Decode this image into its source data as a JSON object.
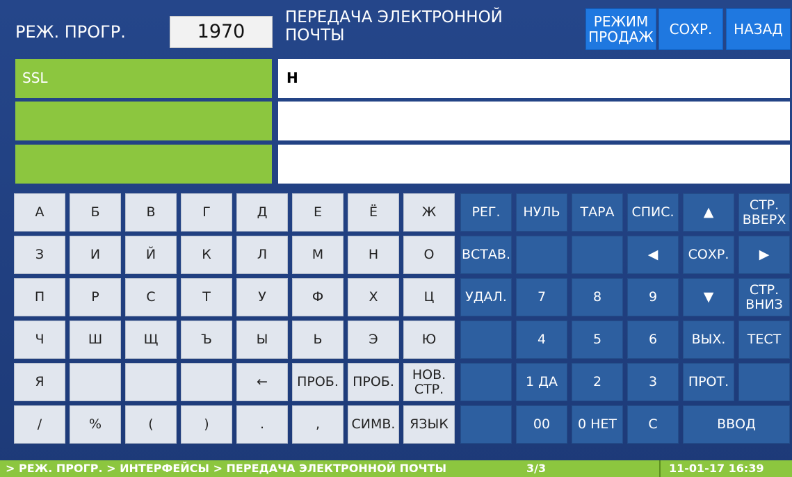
{
  "header": {
    "mode_label": "РЕЖ. ПРОГР.",
    "program_code": "1970",
    "title": "ПЕРЕДАЧА ЭЛЕКТРОННОЙ ПОЧТЫ",
    "buttons": {
      "sales_mode": "РЕЖИМ ПРОДАЖ",
      "save": "СОХР.",
      "back": "НАЗАД"
    },
    "accent_color": "#1f78e0"
  },
  "fields": [
    {
      "label": "SSL",
      "value": "Н"
    },
    {
      "label": "",
      "value": ""
    },
    {
      "label": "",
      "value": ""
    }
  ],
  "keyboard": {
    "letters": {
      "r1": [
        "А",
        "Б",
        "В",
        "Г",
        "Д",
        "Е",
        "Ё",
        "Ж"
      ],
      "r2": [
        "З",
        "И",
        "Й",
        "К",
        "Л",
        "М",
        "Н",
        "О"
      ],
      "r3": [
        "П",
        "Р",
        "С",
        "Т",
        "У",
        "Ф",
        "Х",
        "Ц"
      ],
      "r4": [
        "Ч",
        "Ш",
        "Щ",
        "Ъ",
        "Ы",
        "Ь",
        "Э",
        "Ю"
      ],
      "r5": [
        "Я",
        "",
        "",
        "",
        "←",
        "ПРОБ.",
        "ПРОБ.",
        "НОВ. СТР."
      ],
      "r6": [
        "/",
        "%",
        "(",
        ")",
        ".",
        ",",
        "СИМВ.",
        "ЯЗЫК"
      ]
    },
    "function": {
      "r1": [
        "РЕГ.",
        "НУЛЬ",
        "ТАРА",
        "СПИС.",
        "▲",
        "СТР. ВВЕРХ"
      ],
      "r2": [
        "ВСТАВ.",
        "",
        "",
        "◀",
        "СОХР.",
        "▶"
      ],
      "r3": [
        "УДАЛ.",
        "7",
        "8",
        "9",
        "▼",
        "СТР. ВНИЗ"
      ],
      "r4": [
        "",
        "4",
        "5",
        "6",
        "ВЫХ.",
        "ТЕСТ"
      ],
      "r5": [
        "",
        "1 ДА",
        "2",
        "3",
        "ПРОТ.",
        ""
      ],
      "r6": [
        "",
        "00",
        "0 НЕТ",
        "С",
        "ВВОД"
      ]
    }
  },
  "status": {
    "path": "> РЕЖ. ПРОГР. > ИНТЕРФЕЙСЫ > ПЕРЕДАЧА ЭЛЕКТРОННОЙ ПОЧТЫ",
    "page": "3/3",
    "datetime": "11-01-17  16:39"
  },
  "colors": {
    "label_green": "#8cc63f",
    "key_light": "#e1e6ee",
    "key_dark": "#2d5fa0",
    "background": "#1f3b78"
  }
}
